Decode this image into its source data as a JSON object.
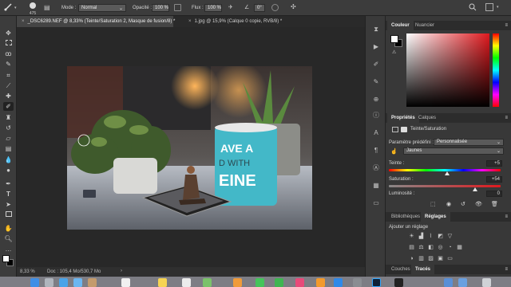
{
  "options_bar": {
    "brush_size": "475",
    "mode_label": "Mode :",
    "mode_value": "Normal",
    "opacity_label": "Opacité :",
    "opacity_value": "100 %",
    "flow_label": "Flux :",
    "flow_value": "100 %",
    "angle_value": "0°"
  },
  "tabs": [
    {
      "label": "_DSC6289.NEF @ 8,33% (Teinte/Saturation 2, Masque de fusion/8) *",
      "close": "×"
    },
    {
      "label": "1.jpg @ 15,9% (Calque 0 copie, RVB/8) *",
      "close": "×"
    }
  ],
  "status_bar": {
    "zoom": "8,33 %",
    "doc": "Doc : 105,4 Mo/530,7 Mo",
    "arrow": "›"
  },
  "color_panel": {
    "tabs": [
      "Couleur",
      "Nuancier"
    ]
  },
  "properties_panel": {
    "tabs": [
      "Propriétés",
      "Calques"
    ],
    "title": "Teinte/Saturation",
    "preset_label": "Paramètre prédéfini :",
    "preset_value": "Personnalisée",
    "channel_value": "Jaunes",
    "hue_label": "Teinte :",
    "hue_value": "+5",
    "hue_fraction": 0.52,
    "saturation_label": "Saturation :",
    "saturation_value": "+54",
    "saturation_fraction": 0.77,
    "lightness_label": "Luminosité :",
    "lightness_value": "0",
    "lightness_fraction": 0.5
  },
  "adjustments_panel": {
    "tabs": [
      "Bibliothèques",
      "Réglages"
    ],
    "add_label": "Ajouter un réglage"
  },
  "paths_panel": {
    "tabs": [
      "Couches",
      "Tracés"
    ]
  },
  "photo": {
    "mug_text_1": "AVE A",
    "mug_text_2": "D WITH",
    "mug_text_3": "EINE"
  },
  "colors": {
    "accent_blue": "#2d8ad6",
    "mug_teal": "#43b8c8",
    "picked_red": "#e0191e"
  }
}
